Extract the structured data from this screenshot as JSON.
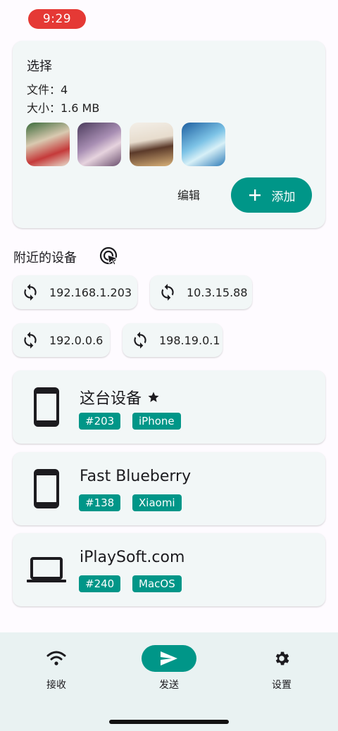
{
  "status": {
    "time": "9:29"
  },
  "selection": {
    "title": "选择",
    "files_line": "文件：4",
    "size_line": "大小：1.6 MB",
    "thumbnails": [
      "thumbnail-1",
      "thumbnail-2",
      "thumbnail-3",
      "thumbnail-4"
    ],
    "edit_label": "编辑",
    "add_label": "添加"
  },
  "nearby": {
    "title": "附近的设备",
    "addresses": [
      "192.168.1.203",
      "10.3.15.88",
      "192.0.0.6",
      "198.19.0.1"
    ]
  },
  "devices": [
    {
      "name": "这台设备",
      "favorite": true,
      "id_tag": "#203",
      "type_tag": "iPhone",
      "icon": "phone-icon"
    },
    {
      "name": "Fast Blueberry",
      "favorite": false,
      "id_tag": "#138",
      "type_tag": "Xiaomi",
      "icon": "phone-icon"
    },
    {
      "name": "iPlaySoft.com",
      "favorite": false,
      "id_tag": "#240",
      "type_tag": "MacOS",
      "icon": "laptop-icon"
    }
  ],
  "nav": {
    "receive_label": "接收",
    "send_label": "发送",
    "settings_label": "设置"
  },
  "colors": {
    "accent": "#009688",
    "card": "#f2f7f7",
    "status_pill": "#e53935"
  }
}
